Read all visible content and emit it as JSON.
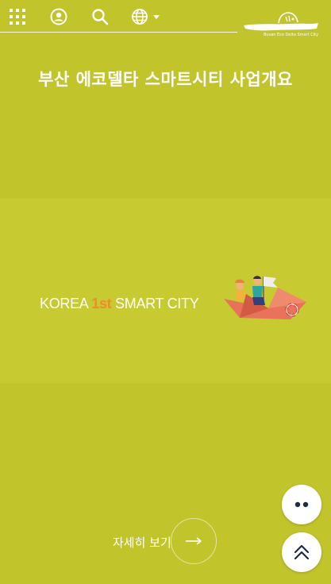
{
  "header": {
    "icons": [
      "grid-menu-icon",
      "user-icon",
      "search-icon",
      "globe-icon",
      "caret-down-icon"
    ],
    "logo_caption": "Busan Eco Delta Smart City"
  },
  "page": {
    "title": "부산 에코델타 스마트시티 사업개요"
  },
  "banner": {
    "text_prefix": "KOREA ",
    "text_accent": "1st",
    "text_suffix": " SMART CITY",
    "accent_color": "#ef8b2c"
  },
  "detail": {
    "label": "자세히 보기",
    "arrow": "→"
  },
  "floating": {
    "more_icon": "more-dots-icon",
    "top_icon": "scroll-top-icon"
  },
  "colors": {
    "background": "#c2c42c",
    "banner": "#c8ca32",
    "fab_icon": "#1f2a44"
  }
}
